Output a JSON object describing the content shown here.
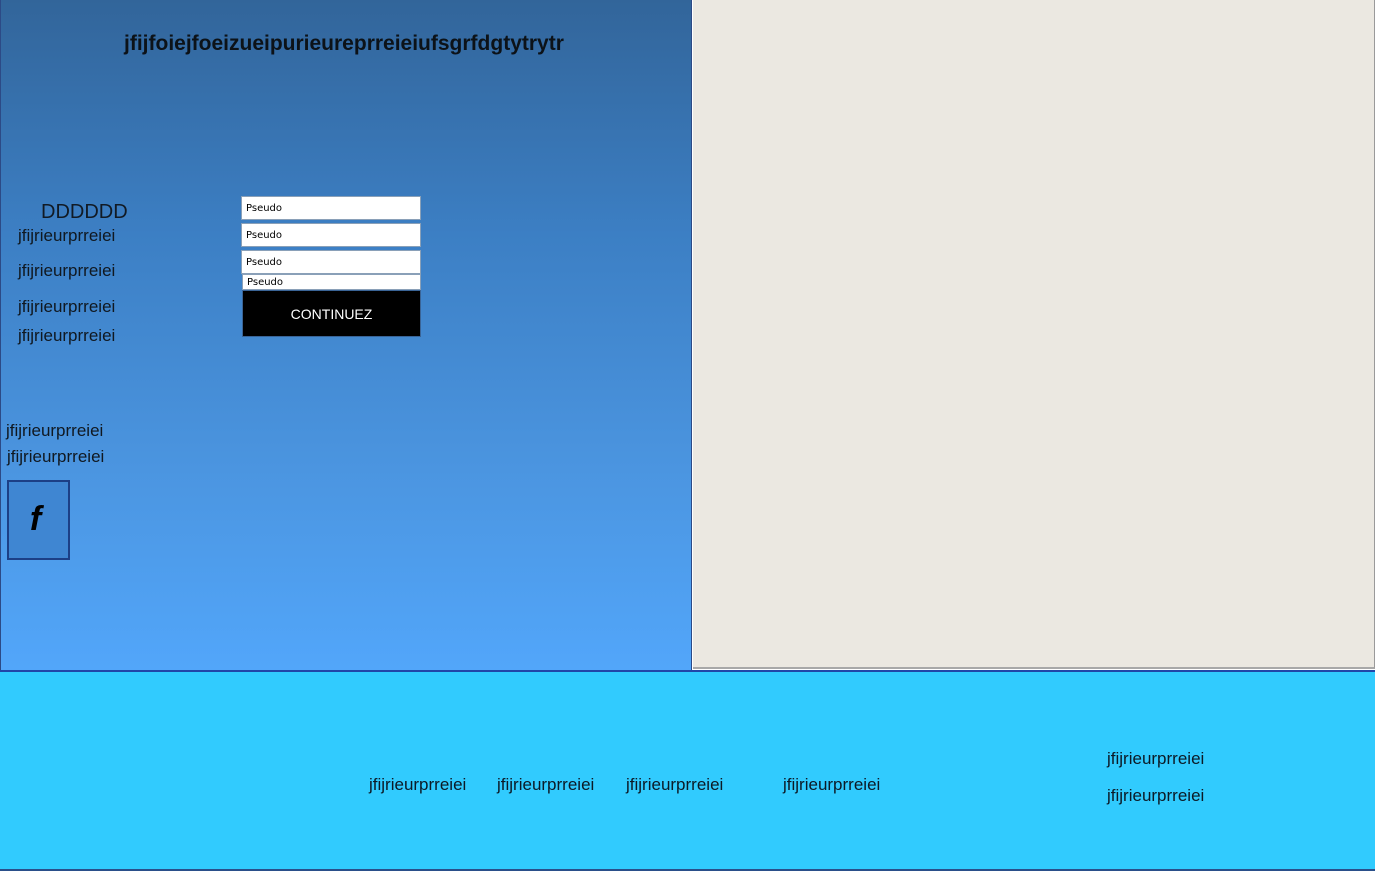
{
  "header": {
    "title": "jfijfoiejfoeizueipurieureprreieiufsgrfdgtytrytr"
  },
  "sidebar": {
    "heading": "DDDDDD",
    "links": [
      "jfijrieurprreiei",
      "jfijrieurprreiei",
      "jfijrieurprreiei",
      "jfijrieurprreiei"
    ],
    "bottom_links": [
      "jfijrieurprreiei",
      "jfijrieurprreiei"
    ],
    "facebook_icon": "facebook-icon",
    "facebook_glyph": "f"
  },
  "form": {
    "fields": [
      {
        "placeholder": "Pseudo"
      },
      {
        "placeholder": "Pseudo"
      },
      {
        "placeholder": "Pseudo"
      },
      {
        "placeholder": "Pseudo"
      }
    ],
    "submit_label": "CONTINUEZ"
  },
  "footer": {
    "links": [
      "jfijrieurprreiei",
      "jfijrieurprreiei",
      "jfijrieurprreiei",
      "jfijrieurprreiei"
    ],
    "right_links": [
      "jfijrieurprreiei",
      "jfijrieurprreiei"
    ]
  },
  "colors": {
    "left_panel_top": "#32659a",
    "left_panel_bottom": "#52a6fa",
    "right_panel": "#ebe8e1",
    "footer": "#31cbfe",
    "button": "#000000"
  }
}
